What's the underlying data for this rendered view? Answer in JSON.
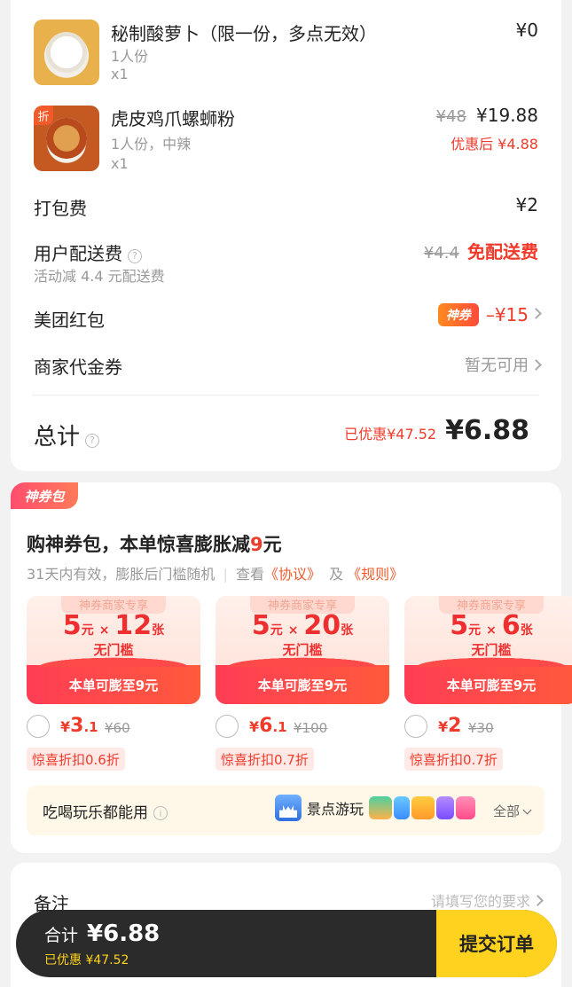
{
  "items": [
    {
      "name": "秘制酸萝卜（限一份，多点无效）",
      "spec": "1人份",
      "qty": "x1",
      "price": "¥0"
    },
    {
      "name": "虎皮鸡爪螺蛳粉",
      "spec": "1人份，中辣",
      "qty": "x1",
      "orig_price": "¥48",
      "price": "¥19.88",
      "after_discount": "优惠后 ¥4.88",
      "badge": "折"
    }
  ],
  "fees": {
    "packing_label": "打包费",
    "packing_value": "¥2",
    "delivery_label": "用户配送费",
    "delivery_sub": "活动减 4.4 元配送费",
    "delivery_orig": "¥4.4",
    "delivery_value": "免配送费",
    "redpack_label": "美团红包",
    "redpack_badge": "神券",
    "redpack_value": "–¥15",
    "voucher_label": "商家代金券",
    "voucher_value": "暂无可用"
  },
  "total": {
    "label": "总计",
    "saved": "已优惠¥47.52",
    "value": "¥6.88"
  },
  "pack": {
    "tag": "神券包",
    "title_pre": "购神券包，本单惊喜膨胀减",
    "title_num": "9",
    "title_post": "元",
    "desc": "31天内有效，膨胀后门槛随机",
    "view": "查看",
    "agreement": "《协议》",
    "and": "及",
    "rules": "《规则》",
    "coupons": [
      {
        "head": "神券商家专享",
        "amount": "5",
        "unit": "元",
        "count": "12",
        "count_unit": "张",
        "threshold": "无门槛",
        "band": "本单可膨至9元",
        "price_int": "3",
        "price_dec": ".1",
        "price_old": "¥60",
        "discount": "惊喜折扣0.6折"
      },
      {
        "head": "神券商家专享",
        "amount": "5",
        "unit": "元",
        "count": "20",
        "count_unit": "张",
        "threshold": "无门槛",
        "band": "本单可膨至9元",
        "price_int": "6",
        "price_dec": ".1",
        "price_old": "¥100",
        "discount": "惊喜折扣0.7折"
      },
      {
        "head": "神券商家专享",
        "amount": "5",
        "unit": "元",
        "count": "6",
        "count_unit": "张",
        "threshold": "无门槛",
        "band": "本单可膨至9元",
        "price_int": "2",
        "price_dec": "",
        "price_old": "¥30",
        "discount": "惊喜折扣0.7折"
      }
    ],
    "use_label": "吃喝玩乐都能用",
    "use_tag": "景点游玩",
    "use_all": "全部"
  },
  "remark": {
    "label": "备注",
    "placeholder": "请填写您的要求"
  },
  "bottom": {
    "total_label": "合计",
    "total_value": "¥6.88",
    "saved": "已优惠 ¥47.52",
    "submit": "提交订单"
  },
  "colors": {
    "accent_red": "#ee3b2b",
    "submit_yellow": "#ffd21f",
    "bar_dark": "#2b2b2b"
  }
}
